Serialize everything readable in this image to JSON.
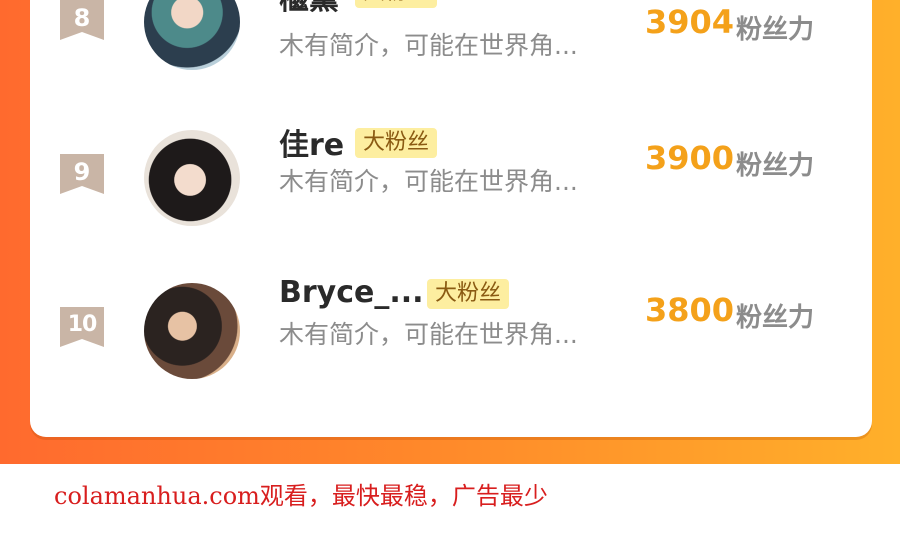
{
  "rows": [
    {
      "rank": "8",
      "name": "檵薰",
      "badge": "大粉丝",
      "desc": "木有简介，可能在世界角...",
      "score": "3904",
      "unit": "粉丝力"
    },
    {
      "rank": "9",
      "name": "佳re",
      "badge": "大粉丝",
      "desc": "木有简介，可能在世界角...",
      "score": "3900",
      "unit": "粉丝力"
    },
    {
      "rank": "10",
      "name": "Bryce_...",
      "badge": "大粉丝",
      "desc": "木有简介，可能在世界角...",
      "score": "3800",
      "unit": "粉丝力"
    }
  ],
  "watermark": "colamanhua.com观看，最快最稳，广告最少",
  "colors": {
    "accent": "#f4a11a",
    "frame_start": "#ff6a2e",
    "frame_end": "#ffb02a",
    "badge_bg": "#fdeea0",
    "watermark": "#d81e1e"
  }
}
